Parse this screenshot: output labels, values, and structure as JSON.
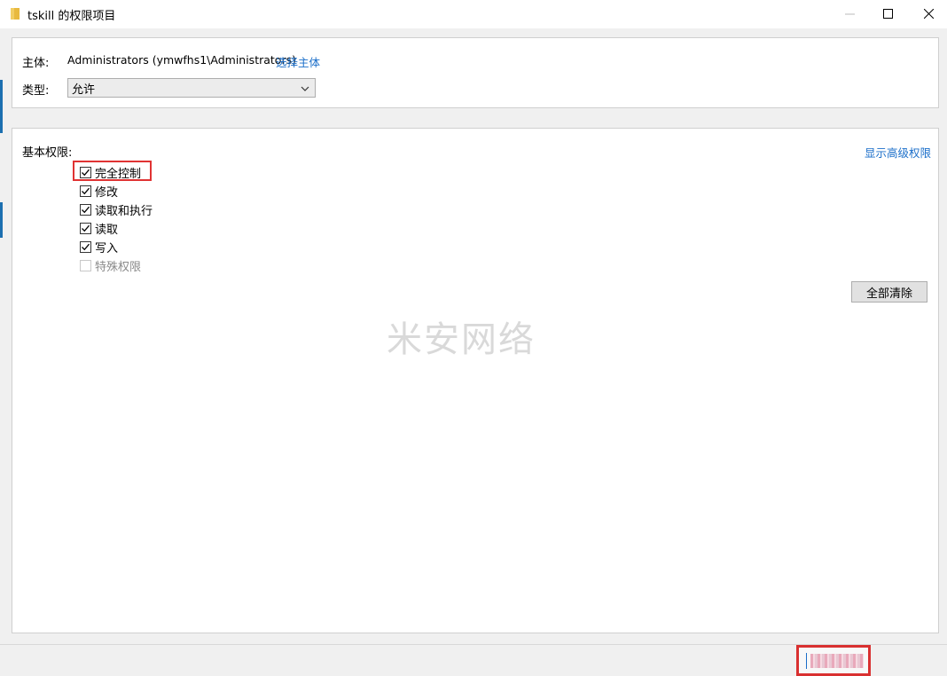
{
  "window": {
    "title": "tskill 的权限项目",
    "icon": "folder-icon"
  },
  "top_panel": {
    "principal_label": "主体:",
    "principal_value": "Administrators (ymwfhs1\\Administrators)",
    "select_principal_link": "选择主体",
    "type_label": "类型:",
    "type_selected": "允许"
  },
  "permissions": {
    "section_label": "基本权限:",
    "show_advanced_link": "显示高级权限",
    "items": [
      {
        "label": "完全控制",
        "checked": true,
        "enabled": true
      },
      {
        "label": "修改",
        "checked": true,
        "enabled": true
      },
      {
        "label": "读取和执行",
        "checked": true,
        "enabled": true
      },
      {
        "label": "读取",
        "checked": true,
        "enabled": true
      },
      {
        "label": "写入",
        "checked": true,
        "enabled": true
      },
      {
        "label": "特殊权限",
        "checked": false,
        "enabled": false
      }
    ],
    "clear_all_button": "全部清除"
  },
  "watermark": "米安网络",
  "colors": {
    "link": "#1a6ec9",
    "highlight": "#e03333"
  }
}
